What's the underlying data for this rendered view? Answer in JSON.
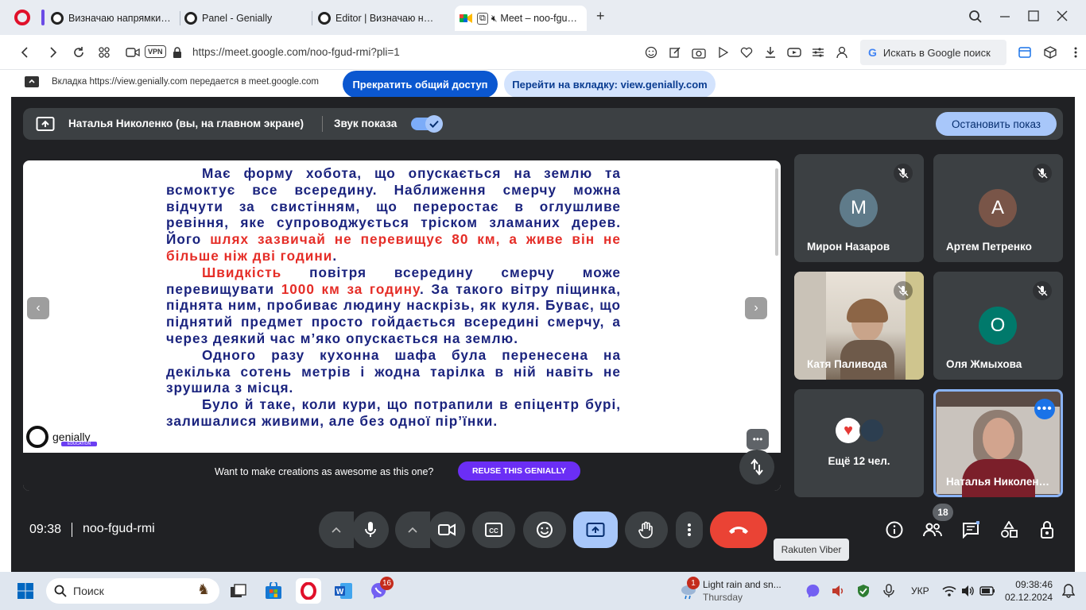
{
  "browser": {
    "tabs": [
      {
        "label": "Визначаю напрямки руху"
      },
      {
        "label": "Panel - Genially"
      },
      {
        "label": "Editor | Визначаю напрям"
      },
      {
        "label": "Meet – noo-fgud-rmi"
      }
    ],
    "new_tab": "+",
    "vpn_label": "VPN",
    "url": "https://meet.google.com/noo-fgud-rmi?pli=1",
    "google_search": "Искать в Google поиск"
  },
  "share_bar": {
    "message": "Вкладка https://view.genially.com передается в meet.google.com",
    "stop_label": "Прекратить общий доступ",
    "goto_label": "Перейти на вкладку: view.genially.com"
  },
  "presenting_bar": {
    "presenter": "Наталья Николенко (вы, на главном экране)",
    "sound_label": "Звук показа",
    "stop_label": "Остановить показ"
  },
  "slide": {
    "p1": "Має форму хобота, що опускається на землю та всмоктує все всередину. Наближення смерчу можна відчути за свистінням, що переростає в оглушливе ревіння, яке супроводжується тріском зламаних дерев. Його ",
    "p1_red": "шлях зазвичай не перевищує 80 км, а живе він не більше ніж дві години",
    "p1_end": ".",
    "p2_red1": "Швидкість",
    "p2_mid": " повітря всередину смерчу може перевищувати ",
    "p2_red2": "1000 км за годину",
    "p2_end": ". За такого вітру піщинка, піднята ним, пробиває людину наскрізь, як куля. Буває, що піднятий предмет просто гойдається всередині смерчу, а через деякий час м’яко опускається на землю.",
    "p3": "Одного разу кухонна шафа була перенесена на декілька сотень метрів і жодна тарілка в ній навіть не зрушила з місця.",
    "p4": "Було й таке, коли кури, що потрапили в епіцентр бурі, залишалися живими, але без одної пір’їнки.",
    "logo_text": "genially",
    "logo_sub": "EDUCATION",
    "footer_text": "Want to make creations as awesome as this one?",
    "reuse_label": "REUSE THIS GENIALLY",
    "prev": "‹",
    "next": "›",
    "more": "•••"
  },
  "participants": [
    {
      "name": "Мирон Назаров",
      "initial": "М",
      "color": "#5f7b8a",
      "muted": true
    },
    {
      "name": "Артем Петренко",
      "initial": "А",
      "color": "#795548",
      "muted": true
    },
    {
      "name": "Катя Паливода",
      "video": true,
      "muted": true
    },
    {
      "name": "Оля Жмыхова",
      "initial": "О",
      "color": "#00796b",
      "muted": true
    },
    {
      "name": "Ещё 12 чел.",
      "others": true
    },
    {
      "name": "Наталья Николен…",
      "video": true,
      "selected": true
    }
  ],
  "controls": {
    "time": "09:38",
    "meeting_code": "noo-fgud-rmi",
    "participant_count": "18",
    "tooltip": "Rakuten Viber"
  },
  "taskbar": {
    "search_placeholder": "Поиск",
    "viber_badge": "16",
    "weather_title": "Light rain and sn...",
    "weather_day": "Thursday",
    "weather_badge": "1",
    "language": "УКР",
    "time": "09:38:46",
    "date": "02.12.2024"
  },
  "colors": {
    "accent": "#0b57d0",
    "meet_bg": "#202124",
    "tile_bg": "#3c4043",
    "end_call": "#ea4335",
    "slide_text": "#1a237e",
    "slide_highlight": "#e52d27",
    "genially_purple": "#6b2ef5"
  }
}
